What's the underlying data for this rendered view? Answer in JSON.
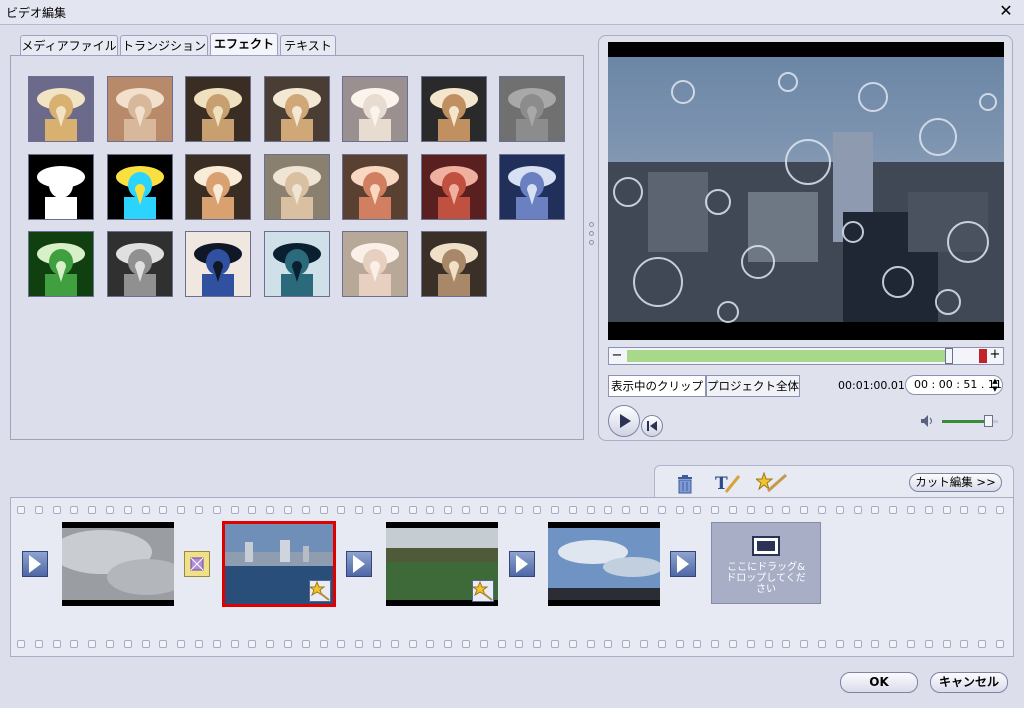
{
  "window": {
    "title": "ビデオ編集"
  },
  "tabs": [
    {
      "label": "メディアファイル",
      "active": false
    },
    {
      "label": "トランジション",
      "active": false
    },
    {
      "label": "エフェクト",
      "active": true
    },
    {
      "label": "テキスト",
      "active": false
    }
  ],
  "effects": [
    {
      "style": "noise"
    },
    {
      "style": "mosaic"
    },
    {
      "style": "sepia-noise"
    },
    {
      "style": "grain"
    },
    {
      "style": "fade"
    },
    {
      "style": "posterize"
    },
    {
      "style": "emboss"
    },
    {
      "style": "sketch"
    },
    {
      "style": "neon"
    },
    {
      "style": "sharp"
    },
    {
      "style": "blur"
    },
    {
      "style": "warm"
    },
    {
      "style": "red"
    },
    {
      "style": "blue"
    },
    {
      "style": "green"
    },
    {
      "style": "gray"
    },
    {
      "style": "negative"
    },
    {
      "style": "negative2"
    },
    {
      "style": "soft"
    },
    {
      "style": "kaleido"
    }
  ],
  "preview": {
    "tabs": [
      "表示中のクリップ",
      "プロジェクト全体"
    ],
    "elapsed": "00:01:00.01",
    "timecode": "00 : 00 : 51 . 11",
    "progress": 0.93,
    "volume": 0.82
  },
  "timeline": {
    "cut_edit_label": "カット編集 >>",
    "drop_hint": "ここにドラッグ&ドロップしてください"
  },
  "footer": {
    "ok": "OK",
    "cancel": "キャンセル"
  },
  "colors": {
    "selected_clip_border": "#e00000",
    "seek_fill": "#a8d98a",
    "volume_fill": "#3a8a3a"
  }
}
